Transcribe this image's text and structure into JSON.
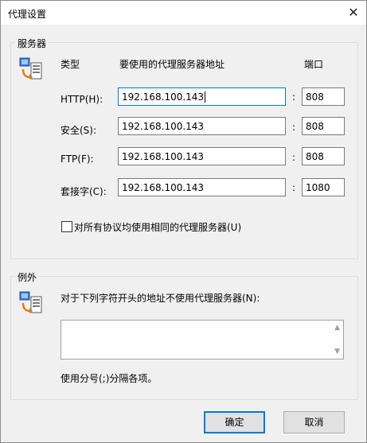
{
  "window": {
    "title": "代理设置",
    "close_glyph": "✕"
  },
  "servers": {
    "group_label": "服务器",
    "header_type": "类型",
    "header_address": "要使用的代理服务器地址",
    "header_port": "端口",
    "separator": ":",
    "rows": [
      {
        "label": "HTTP(H):",
        "address": "192.168.100.143",
        "port": "808"
      },
      {
        "label": "安全(S):",
        "address": "192.168.100.143",
        "port": "808"
      },
      {
        "label": "FTP(F):",
        "address": "192.168.100.143",
        "port": "808"
      },
      {
        "label": "套接字(C):",
        "address": "192.168.100.143",
        "port": "1080"
      }
    ],
    "same_proxy_label": "对所有协议均使用相同的代理服务器(U)"
  },
  "exceptions": {
    "group_label": "例外",
    "instruction": "对于下列字符开头的地址不使用代理服务器(N):",
    "value": "",
    "hint": "使用分号(;)分隔各项。"
  },
  "buttons": {
    "ok": "确定",
    "cancel": "取消"
  }
}
